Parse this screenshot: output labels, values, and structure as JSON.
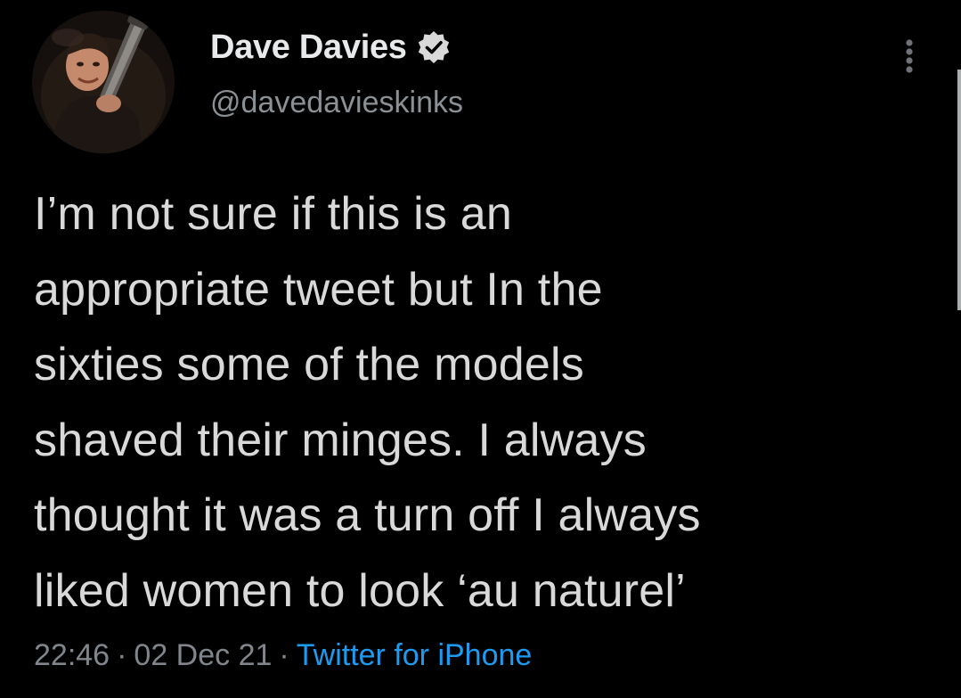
{
  "tweet": {
    "author": {
      "display_name": "Dave Davies",
      "handle": "@davedavieskinks",
      "verified": true,
      "avatar_icon": "profile-photo-guitarist"
    },
    "body": "I’m not sure if this is an\nappropriate tweet but In the\nsixties some of the models\nshaved their minges. I always\nthought it was a turn off I always\nliked women to look ‘au naturel’",
    "time": "22:46",
    "date": "02 Dec 21",
    "separator": "·",
    "source": "Twitter for iPhone",
    "more_icon": "more-vertical-icon"
  },
  "colors": {
    "background": "#000000",
    "name": "#e7e9ea",
    "body_text": "#d9d9d9",
    "secondary_text": "#80868b",
    "link": "#1d9bf0",
    "verified_badge": "#d9d9d9"
  }
}
